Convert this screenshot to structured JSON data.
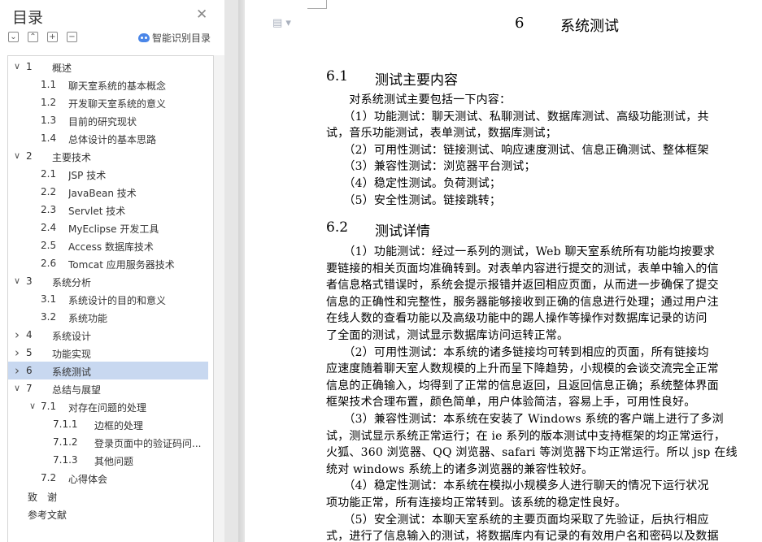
{
  "sidebar": {
    "title": "目录",
    "smart_label": "智能识别目录",
    "toc": [
      {
        "num": "1",
        "label": "概述",
        "level": 1,
        "toggle": "expanded"
      },
      {
        "num": "1.1",
        "label": "聊天室系统的基本概念",
        "level": 2
      },
      {
        "num": "1.2",
        "label": "开发聊天室系统的意义",
        "level": 2
      },
      {
        "num": "1.3",
        "label": "目前的研究现状",
        "level": 2
      },
      {
        "num": "1.4",
        "label": "总体设计的基本思路",
        "level": 2
      },
      {
        "num": "2",
        "label": "主要技术",
        "level": 1,
        "toggle": "expanded"
      },
      {
        "num": "2.1",
        "label": "JSP 技术",
        "level": 2
      },
      {
        "num": "2.2",
        "label": "JavaBean 技术",
        "level": 2
      },
      {
        "num": "2.3",
        "label": "Servlet 技术",
        "level": 2
      },
      {
        "num": "2.4",
        "label": "MyEclipse 开发工具",
        "level": 2
      },
      {
        "num": "2.5",
        "label": "Access 数据库技术",
        "level": 2
      },
      {
        "num": "2.6",
        "label": "Tomcat 应用服务器技术",
        "level": 2
      },
      {
        "num": "3",
        "label": "系统分析",
        "level": 1,
        "toggle": "expanded"
      },
      {
        "num": "3.1",
        "label": "系统设计的目的和意义",
        "level": 2
      },
      {
        "num": "3.2",
        "label": "系统功能",
        "level": 2
      },
      {
        "num": "4",
        "label": "系统设计",
        "level": 1,
        "toggle": "collapsed"
      },
      {
        "num": "5",
        "label": "功能实现",
        "level": 1,
        "toggle": "collapsed"
      },
      {
        "num": "6",
        "label": "系统测试",
        "level": 1,
        "toggle": "collapsed",
        "selected": true
      },
      {
        "num": "7",
        "label": "总结与展望",
        "level": 1,
        "toggle": "expanded"
      },
      {
        "num": "7.1",
        "label": "对存在问题的处理",
        "level": 2,
        "toggle": "expanded"
      },
      {
        "num": "7.1.1",
        "label": "边框的处理",
        "level": 3
      },
      {
        "num": "7.1.2",
        "label": "登录页面中的验证码问...",
        "level": 3
      },
      {
        "num": "7.1.3",
        "label": "其他问题",
        "level": 3
      },
      {
        "num": "7.2",
        "label": "心得体会",
        "level": 2
      },
      {
        "num": "",
        "label": "致　谢",
        "level": 0
      },
      {
        "num": "",
        "label": "参考文献",
        "level": 0
      }
    ]
  },
  "document": {
    "chapter_num": "6",
    "chapter_title": "系统测试",
    "s1_num": "6.1",
    "s1_title": "测试主要内容",
    "s1_lines": [
      "　　对系统测试主要包括一下内容：",
      "　　（1）功能测试：聊天测试、私聊测试、数据库测试、高级功能测试，共",
      "试，音乐功能测试，表单测试，数据库测试；",
      "　　（2）可用性测试：链接测试、响应速度测试、信息正确测试、整体框架",
      "　　（3）兼容性测试：浏览器平台测试；",
      "　　（4）稳定性测试。负荷测试；",
      "　　（5）安全性测试。链接跳转；"
    ],
    "s2_num": "6.2",
    "s2_title": "测试详情",
    "s2_lines": [
      "　　（1）功能测试：经过一系列的测试，Web 聊天室系统所有功能均按要求",
      "要链接的相关页面均准确转到。对表单内容进行提交的测试，表单中输入的信",
      "者信息格式错误时，系统会提示报错并返回相应页面，从而进一步确保了提交",
      "信息的正确性和完整性，服务器能够接收到正确的信息进行处理；通过用户注",
      "在线人数的查看功能以及高级功能中的踢人操作等操作对数据库记录的访问",
      "了全面的测试，测试显示数据库访问运转正常。",
      "　　（2）可用性测试：本系统的诸多链接均可转到相应的页面，所有链接均",
      "应速度随着聊天室人数规模的上升而呈下降趋势，小规模的会谈交流完全正常",
      "信息的正确输入，均得到了正常的信息返回，且返回信息正确；系统整体界面",
      "框架技术合理布置，颜色简单，用户体验简洁，容易上手，可用性良好。",
      "　　（3）兼容性测试：本系统在安装了 Windows 系统的客户端上进行了多浏",
      "试，测试显示系统正常运行；在 ie 系列的版本测试中支持框架的均正常运行，",
      "火狐、360 浏览器、QQ 浏览器、safari 等浏览器下均正常运行。所以 jsp 在线",
      "统对 windows 系统上的诸多浏览器的兼容性较好。",
      "　　（4）稳定性测试：本系统在模拟小规模多人进行聊天的情况下运行状况",
      "项功能正常，所有连接均正常转到。该系统的稳定性良好。",
      "　　（5）安全测试：本聊天室系统的主要页面均采取了先验证，后执行相应",
      "式，进行了信息输入的测试，将数据库内有记录的有效用户名和密码以及数据"
    ]
  }
}
